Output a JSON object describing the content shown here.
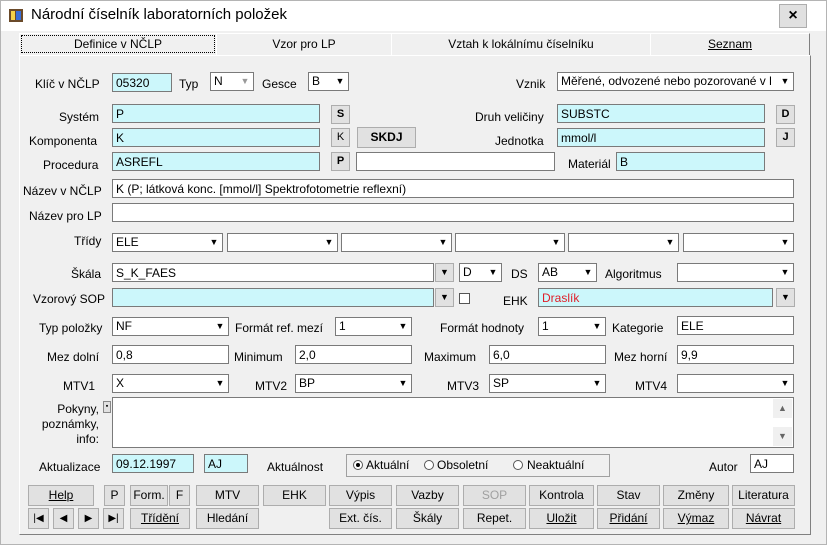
{
  "window": {
    "title": "Národní číselník laboratorních položek",
    "close": "×"
  },
  "tabs": [
    {
      "label": "Definice v NČLP"
    },
    {
      "label": "Vzor pro LP"
    },
    {
      "label": "Vztah k lokálnímu číselníku"
    },
    {
      "label": "Seznam"
    }
  ],
  "form": {
    "klic_label": "Klíč v NČLP",
    "klic_value": "05320",
    "typ_label": "Typ",
    "typ_value": "N",
    "gesce_label": "Gesce",
    "gesce_value": "B",
    "vznik_label": "Vznik",
    "vznik_value": "Měřené, odvozené nebo pozorované v l",
    "system_label": "Systém",
    "system_value": "P",
    "system_btn": "S",
    "druh_label": "Druh veličiny",
    "druh_value": "SUBSTC",
    "druh_btn": "D",
    "komponenta_label": "Komponenta",
    "komponenta_value": "K",
    "komponenta_btn": "K",
    "skdj_btn": "SKDJ",
    "jednotka_label": "Jednotka",
    "jednotka_value": "mmol/l",
    "jednotka_btn": "J",
    "procedura_label": "Procedura",
    "procedura_value": "ASREFL",
    "procedura_btn": "P",
    "material_label": "Materiál",
    "material_value": "B",
    "nazev_label": "Název v NČLP",
    "nazev_value": "K (P; látková konc. [mmol/l] Spektrofotometrie reflexní)",
    "nazev_lp_label": "Název pro LP",
    "nazev_lp_value": "",
    "tridy_label": "Třídy",
    "tridy_values": [
      "ELE",
      "",
      "",
      "",
      "",
      ""
    ],
    "skala_label": "Škála",
    "skala_value": "S_K_FAES",
    "skala_d": "D",
    "ds_label": "DS",
    "ds_value": "AB",
    "algoritmus_label": "Algoritmus",
    "algoritmus_value": "",
    "sop_label": "Vzorový SOP",
    "sop_value": "",
    "ehk_label": "EHK",
    "ehk_value": "Draslík",
    "typ_polozky_label": "Typ položky",
    "typ_polozky_value": "NF",
    "format_mezi_label": "Formát ref. mezí",
    "format_mezi_value": "1",
    "format_hodnoty_label": "Formát hodnoty",
    "format_hodnoty_value": "1",
    "kategorie_label": "Kategorie",
    "kategorie_value": "ELE",
    "mez_dolni_label": "Mez dolní",
    "mez_dolni_value": "0,8",
    "minimum_label": "Minimum",
    "minimum_value": "2,0",
    "maximum_label": "Maximum",
    "maximum_value": "6,0",
    "mez_horni_label": "Mez horní",
    "mez_horni_value": "9,9",
    "mtv1_label": "MTV1",
    "mtv1_value": "X",
    "mtv2_label": "MTV2",
    "mtv2_value": "BP",
    "mtv3_label": "MTV3",
    "mtv3_value": "SP",
    "mtv4_label": "MTV4",
    "mtv4_value": "",
    "pokyny_label1": "Pokyny,",
    "pokyny_label2": "poznámky,",
    "pokyny_label3": "info:",
    "aktualizace_label": "Aktualizace",
    "aktualizace_date": "09.12.1997",
    "aktualizace_user": "AJ",
    "aktualnost_label": "Aktuálnost",
    "aktualnost_options": [
      "Aktuální",
      "Obsoletní",
      "Neaktuální"
    ],
    "autor_label": "Autor",
    "autor_value": "AJ"
  },
  "buttons_row1": [
    "Help",
    "P",
    "Form.",
    "F",
    "MTV",
    "EHK",
    "Výpis",
    "Vazby",
    "SOP",
    "Kontrola",
    "Stav",
    "Změny",
    "Literatura"
  ],
  "buttons_row2": [
    "Třídění",
    "Hledání",
    "Ext. čís.",
    "Škály",
    "Repet.",
    "Uložit",
    "Přidání",
    "Výmaz",
    "Návrat"
  ],
  "nav": [
    "first",
    "prev",
    "next",
    "last"
  ]
}
